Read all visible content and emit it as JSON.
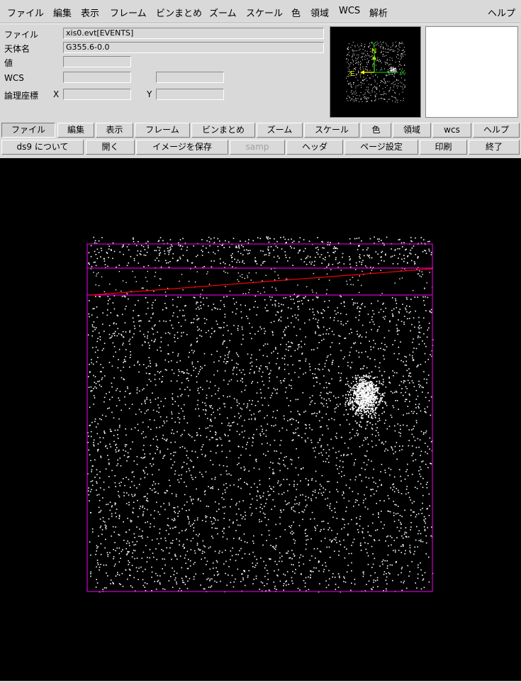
{
  "menu": {
    "items": [
      "ファイル",
      "編集",
      "表示",
      "フレーム",
      "ビンまとめ",
      "ズーム",
      "スケール",
      "色",
      "領域",
      "WCS",
      "解析"
    ],
    "help": "ヘルプ"
  },
  "info": {
    "file_label": "ファイル",
    "file_value": "xis0.evt[EVENTS]",
    "object_label": "天体名",
    "object_value": "G355.6-0.0",
    "value_label": "値",
    "value_value": "",
    "wcs_label": "WCS",
    "wcs_value1": "",
    "wcs_value2": "",
    "logical_label": "論理座標",
    "x_label": "X",
    "x_value": "",
    "y_label": "Y",
    "y_value": ""
  },
  "panner": {
    "n_label": "N",
    "e_label": "E",
    "x_label": "X",
    "y_label": "Y",
    "compass_color": "#ffff00",
    "axis_color": "#00ff00"
  },
  "buttonbar1": [
    "ファイル",
    "編集",
    "表示",
    "フレーム",
    "ビンまとめ",
    "ズーム",
    "スケール",
    "色",
    "領域",
    "wcs",
    "ヘルプ"
  ],
  "buttonbar2": [
    "ds9 について",
    "開く",
    "イメージを保存",
    "samp",
    "ヘッダ",
    "ページ設定",
    "印刷",
    "終了"
  ],
  "canvas": {
    "background": "#000000",
    "region_color": "#cc00cc",
    "line_color": "#ff0000",
    "point_color": "#ffffff"
  }
}
